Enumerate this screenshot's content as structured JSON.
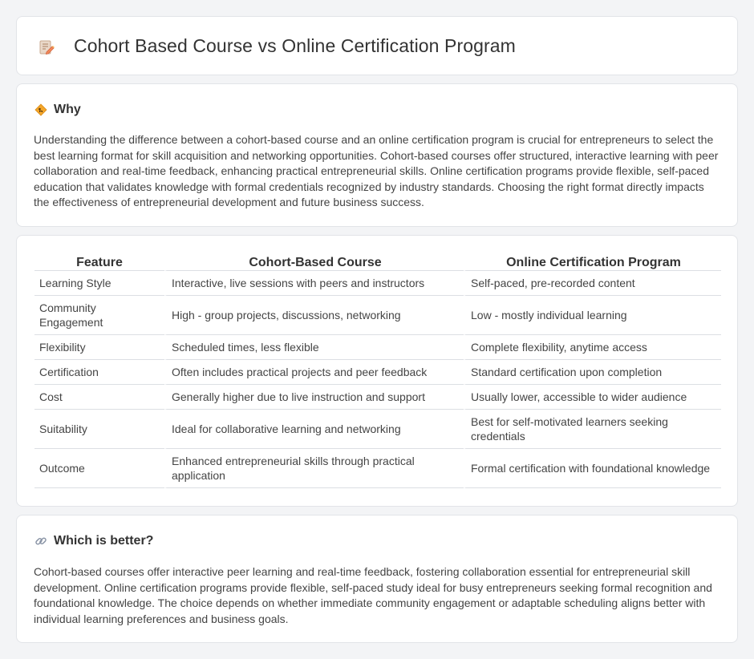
{
  "page": {
    "title": "Cohort Based Course vs Online Certification Program",
    "icon": "document-edit-icon"
  },
  "why": {
    "heading": "Why",
    "icon": "diamond-sign-icon",
    "text": "Understanding the difference between a cohort-based course and an online certification program is crucial for entrepreneurs to select the best learning format for skill acquisition and networking opportunities. Cohort-based courses offer structured, interactive learning with peer collaboration and real-time feedback, enhancing practical entrepreneurial skills. Online certification programs provide flexible, self-paced education that validates knowledge with formal credentials recognized by industry standards. Choosing the right format directly impacts the effectiveness of entrepreneurial development and future business success."
  },
  "table": {
    "headers": [
      "Feature",
      "Cohort-Based Course",
      "Online Certification Program"
    ],
    "rows": [
      [
        "Learning Style",
        "Interactive, live sessions with peers and instructors",
        "Self-paced, pre-recorded content"
      ],
      [
        "Community Engagement",
        "High - group projects, discussions, networking",
        "Low - mostly individual learning"
      ],
      [
        "Flexibility",
        "Scheduled times, less flexible",
        "Complete flexibility, anytime access"
      ],
      [
        "Certification",
        "Often includes practical projects and peer feedback",
        "Standard certification upon completion"
      ],
      [
        "Cost",
        "Generally higher due to live instruction and support",
        "Usually lower, accessible to wider audience"
      ],
      [
        "Suitability",
        "Ideal for collaborative learning and networking",
        "Best for self-motivated learners seeking credentials"
      ],
      [
        "Outcome",
        "Enhanced entrepreneurial skills through practical application",
        "Formal certification with foundational knowledge"
      ]
    ]
  },
  "better": {
    "heading": "Which is better?",
    "icon": "link-icon",
    "text": "Cohort-based courses offer interactive peer learning and real-time feedback, fostering collaboration essential for entrepreneurial skill development. Online certification programs provide flexible, self-paced study ideal for busy entrepreneurs seeking formal recognition and foundational knowledge. The choice depends on whether immediate community engagement or adaptable scheduling aligns better with individual learning preferences and business goals."
  }
}
